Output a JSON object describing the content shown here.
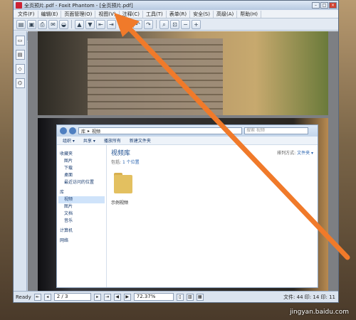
{
  "window": {
    "title": "全页预片.pdf - Foxit Phantom - [全页预片.pdf]"
  },
  "menu": [
    "文件(F)",
    "编辑(E)",
    "页面管理(O)",
    "视图(V)",
    "注释(C)",
    "工具(T)",
    "表单(R)",
    "安全(S)",
    "高级(A)",
    "帮助(H)"
  ],
  "toolbar_icons": [
    "open-icon",
    "save-icon",
    "print-icon",
    "email-icon",
    "scan-icon",
    "prev-icon",
    "next-icon",
    "first-icon",
    "last-icon",
    "rotate-icon",
    "undo-icon",
    "redo-icon",
    "zoom-icon",
    "fit-icon",
    "zoom-out-icon",
    "zoom-in-icon",
    "hand-icon",
    "select-icon",
    "text-icon",
    "typewriter-icon",
    "link-icon",
    "image-icon",
    "comment-icon",
    "lock-icon",
    "sign-icon",
    "note-icon"
  ],
  "explorer": {
    "path": [
      "库",
      "视频"
    ],
    "search_placeholder": "搜索 视频",
    "commands": [
      "组织 ▾",
      "共享 ▾",
      "播放所有",
      "新建文件夹"
    ],
    "nav": [
      {
        "label": "收藏夹",
        "head": true
      },
      {
        "label": "图片"
      },
      {
        "label": "下载"
      },
      {
        "label": "桌面"
      },
      {
        "label": "最近访问的位置"
      },
      {
        "label": "库",
        "head": true
      },
      {
        "label": "视频",
        "selected": true
      },
      {
        "label": "图片"
      },
      {
        "label": "文档"
      },
      {
        "label": "音乐"
      },
      {
        "label": "计算机",
        "head": true
      },
      {
        "label": "网络",
        "head": true
      }
    ],
    "library_title": "视频库",
    "library_sub_prefix": "包括: ",
    "library_sub_link": "1 个位置",
    "arrange_label": "排列方式:",
    "arrange_value": "文件夹 ▾",
    "folder_name": "示例视频"
  },
  "status": {
    "ready": "Ready",
    "page": "2 / 3",
    "zoom": "72.37%",
    "right": "文件: 44 印: 14 印: 11"
  },
  "watermark": "jingyan.baidu.com",
  "colors": {
    "arrow": "#f07a2a",
    "accent": "#2a64b0"
  }
}
